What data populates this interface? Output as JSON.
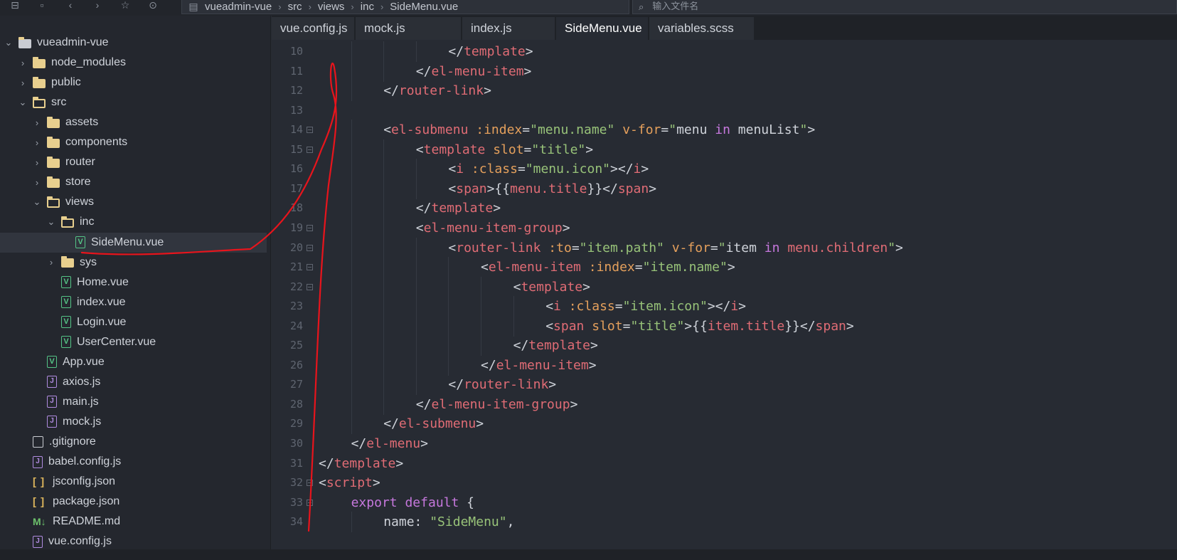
{
  "toolbar": {
    "breadcrumb": [
      "vueadmin-vue",
      "src",
      "views",
      "inc",
      "SideMenu.vue"
    ],
    "search_placeholder": "输入文件名"
  },
  "sidebar": {
    "items": [
      {
        "label": "vueadmin-vue",
        "icon": "project-icon",
        "chevron": "down"
      },
      {
        "label": "node_modules",
        "icon": "folder-icon",
        "chevron": "right"
      },
      {
        "label": "public",
        "icon": "folder-icon",
        "chevron": "right"
      },
      {
        "label": "src",
        "icon": "folder-open-icon",
        "chevron": "down"
      },
      {
        "label": "assets",
        "icon": "folder-icon",
        "chevron": "right"
      },
      {
        "label": "components",
        "icon": "folder-icon",
        "chevron": "right"
      },
      {
        "label": "router",
        "icon": "folder-icon",
        "chevron": "right"
      },
      {
        "label": "store",
        "icon": "folder-icon",
        "chevron": "right"
      },
      {
        "label": "views",
        "icon": "folder-open-icon",
        "chevron": "down"
      },
      {
        "label": "inc",
        "icon": "folder-open-icon",
        "chevron": "down"
      },
      {
        "label": "SideMenu.vue",
        "icon": "vue-file-icon",
        "chevron": ""
      },
      {
        "label": "sys",
        "icon": "folder-icon",
        "chevron": "right"
      },
      {
        "label": "Home.vue",
        "icon": "vue-file-icon",
        "chevron": ""
      },
      {
        "label": "index.vue",
        "icon": "vue-file-icon",
        "chevron": ""
      },
      {
        "label": "Login.vue",
        "icon": "vue-file-icon",
        "chevron": ""
      },
      {
        "label": "UserCenter.vue",
        "icon": "vue-file-icon",
        "chevron": ""
      },
      {
        "label": "App.vue",
        "icon": "vue-file-icon",
        "chevron": ""
      },
      {
        "label": "axios.js",
        "icon": "js-file-icon",
        "chevron": ""
      },
      {
        "label": "main.js",
        "icon": "js-file-icon",
        "chevron": ""
      },
      {
        "label": "mock.js",
        "icon": "js-file-icon",
        "chevron": ""
      },
      {
        "label": ".gitignore",
        "icon": "text-file-icon",
        "chevron": ""
      },
      {
        "label": "babel.config.js",
        "icon": "js-file-icon",
        "chevron": ""
      },
      {
        "label": "jsconfig.json",
        "icon": "json-file-icon",
        "chevron": ""
      },
      {
        "label": "package.json",
        "icon": "json-file-icon",
        "chevron": ""
      },
      {
        "label": "README.md",
        "icon": "markdown-file-icon",
        "chevron": ""
      },
      {
        "label": "vue.config.js",
        "icon": "js-file-icon",
        "chevron": ""
      }
    ]
  },
  "tabs": [
    {
      "label": "vue.config.js",
      "active": false
    },
    {
      "label": "mock.js",
      "active": false
    },
    {
      "label": "index.js",
      "active": false
    },
    {
      "label": "SideMenu.vue",
      "active": true
    },
    {
      "label": "variables.scss",
      "active": false
    }
  ],
  "editor": {
    "lines": [
      {
        "n": "10",
        "fold": false,
        "indent": 4,
        "tokens": [
          [
            "pun",
            "</"
          ],
          [
            "tag",
            "template"
          ],
          [
            "pun",
            ">"
          ]
        ]
      },
      {
        "n": "11",
        "fold": false,
        "indent": 3,
        "tokens": [
          [
            "pun",
            "</"
          ],
          [
            "tag",
            "el-menu-item"
          ],
          [
            "pun",
            ">"
          ]
        ]
      },
      {
        "n": "12",
        "fold": false,
        "indent": 2,
        "tokens": [
          [
            "pun",
            "</"
          ],
          [
            "tag",
            "router-link"
          ],
          [
            "pun",
            ">"
          ]
        ]
      },
      {
        "n": "13",
        "fold": false,
        "indent": 0,
        "tokens": []
      },
      {
        "n": "14",
        "fold": true,
        "indent": 2,
        "tokens": [
          [
            "pun",
            "<"
          ],
          [
            "tag",
            "el-submenu"
          ],
          [
            "pun",
            " "
          ],
          [
            "attr",
            ":index"
          ],
          [
            "pun",
            "="
          ],
          [
            "str",
            "\"menu.name\""
          ],
          [
            "pun",
            " "
          ],
          [
            "attr",
            "v-for"
          ],
          [
            "pun",
            "="
          ],
          [
            "str",
            "\""
          ],
          [
            "pun",
            "menu "
          ],
          [
            "kw",
            "in"
          ],
          [
            "pun",
            " menuList"
          ],
          [
            "str",
            "\""
          ],
          [
            "pun",
            ">"
          ]
        ]
      },
      {
        "n": "15",
        "fold": true,
        "indent": 3,
        "tokens": [
          [
            "pun",
            "<"
          ],
          [
            "tag",
            "template"
          ],
          [
            "pun",
            " "
          ],
          [
            "attr",
            "slot"
          ],
          [
            "pun",
            "="
          ],
          [
            "str",
            "\"title\""
          ],
          [
            "pun",
            ">"
          ]
        ]
      },
      {
        "n": "16",
        "fold": false,
        "indent": 4,
        "tokens": [
          [
            "pun",
            "<"
          ],
          [
            "tag",
            "i"
          ],
          [
            "pun",
            " "
          ],
          [
            "attr",
            ":class"
          ],
          [
            "pun",
            "="
          ],
          [
            "str",
            "\"menu.icon\""
          ],
          [
            "pun",
            "></"
          ],
          [
            "tag",
            "i"
          ],
          [
            "pun",
            ">"
          ]
        ]
      },
      {
        "n": "17",
        "fold": false,
        "indent": 4,
        "tokens": [
          [
            "pun",
            "<"
          ],
          [
            "tag",
            "span"
          ],
          [
            "pun",
            ">{{"
          ],
          [
            "tag",
            "menu.title"
          ],
          [
            "pun",
            "}}</"
          ],
          [
            "tag",
            "span"
          ],
          [
            "pun",
            ">"
          ]
        ]
      },
      {
        "n": "18",
        "fold": false,
        "indent": 3,
        "tokens": [
          [
            "pun",
            "</"
          ],
          [
            "tag",
            "template"
          ],
          [
            "pun",
            ">"
          ]
        ]
      },
      {
        "n": "19",
        "fold": true,
        "indent": 3,
        "tokens": [
          [
            "pun",
            "<"
          ],
          [
            "tag",
            "el-menu-item-group"
          ],
          [
            "pun",
            ">"
          ]
        ]
      },
      {
        "n": "20",
        "fold": true,
        "indent": 4,
        "tokens": [
          [
            "pun",
            "<"
          ],
          [
            "tag",
            "router-link"
          ],
          [
            "pun",
            " "
          ],
          [
            "attr",
            ":to"
          ],
          [
            "pun",
            "="
          ],
          [
            "str",
            "\"item.path\""
          ],
          [
            "pun",
            " "
          ],
          [
            "attr",
            "v-for"
          ],
          [
            "pun",
            "="
          ],
          [
            "str",
            "\""
          ],
          [
            "pun",
            "item "
          ],
          [
            "kw",
            "in"
          ],
          [
            "pun",
            " "
          ],
          [
            "tag",
            "menu.children"
          ],
          [
            "str",
            "\""
          ],
          [
            "pun",
            ">"
          ]
        ]
      },
      {
        "n": "21",
        "fold": true,
        "indent": 5,
        "tokens": [
          [
            "pun",
            "<"
          ],
          [
            "tag",
            "el-menu-item"
          ],
          [
            "pun",
            " "
          ],
          [
            "attr",
            ":index"
          ],
          [
            "pun",
            "="
          ],
          [
            "str",
            "\"item.name\""
          ],
          [
            "pun",
            ">"
          ]
        ]
      },
      {
        "n": "22",
        "fold": true,
        "indent": 6,
        "tokens": [
          [
            "pun",
            "<"
          ],
          [
            "tag",
            "template"
          ],
          [
            "pun",
            ">"
          ]
        ]
      },
      {
        "n": "23",
        "fold": false,
        "indent": 7,
        "tokens": [
          [
            "pun",
            "<"
          ],
          [
            "tag",
            "i"
          ],
          [
            "pun",
            " "
          ],
          [
            "attr",
            ":class"
          ],
          [
            "pun",
            "="
          ],
          [
            "str",
            "\"item.icon\""
          ],
          [
            "pun",
            "></"
          ],
          [
            "tag",
            "i"
          ],
          [
            "pun",
            ">"
          ]
        ]
      },
      {
        "n": "24",
        "fold": false,
        "indent": 7,
        "tokens": [
          [
            "pun",
            "<"
          ],
          [
            "tag",
            "span"
          ],
          [
            "pun",
            " "
          ],
          [
            "attr",
            "slot"
          ],
          [
            "pun",
            "="
          ],
          [
            "str",
            "\"title\""
          ],
          [
            "pun",
            ">{{"
          ],
          [
            "tag",
            "item.title"
          ],
          [
            "pun",
            "}}</"
          ],
          [
            "tag",
            "span"
          ],
          [
            "pun",
            ">"
          ]
        ]
      },
      {
        "n": "25",
        "fold": false,
        "indent": 6,
        "tokens": [
          [
            "pun",
            "</"
          ],
          [
            "tag",
            "template"
          ],
          [
            "pun",
            ">"
          ]
        ]
      },
      {
        "n": "26",
        "fold": false,
        "indent": 5,
        "tokens": [
          [
            "pun",
            "</"
          ],
          [
            "tag",
            "el-menu-item"
          ],
          [
            "pun",
            ">"
          ]
        ]
      },
      {
        "n": "27",
        "fold": false,
        "indent": 4,
        "tokens": [
          [
            "pun",
            "</"
          ],
          [
            "tag",
            "router-link"
          ],
          [
            "pun",
            ">"
          ]
        ]
      },
      {
        "n": "28",
        "fold": false,
        "indent": 3,
        "tokens": [
          [
            "pun",
            "</"
          ],
          [
            "tag",
            "el-menu-item-group"
          ],
          [
            "pun",
            ">"
          ]
        ]
      },
      {
        "n": "29",
        "fold": false,
        "indent": 2,
        "tokens": [
          [
            "pun",
            "</"
          ],
          [
            "tag",
            "el-submenu"
          ],
          [
            "pun",
            ">"
          ]
        ]
      },
      {
        "n": "30",
        "fold": false,
        "indent": 1,
        "tokens": [
          [
            "pun",
            "</"
          ],
          [
            "tag",
            "el-menu"
          ],
          [
            "pun",
            ">"
          ]
        ]
      },
      {
        "n": "31",
        "fold": false,
        "indent": 0,
        "tokens": [
          [
            "pun",
            "</"
          ],
          [
            "tag",
            "template"
          ],
          [
            "pun",
            ">"
          ]
        ]
      },
      {
        "n": "32",
        "fold": true,
        "indent": 0,
        "tokens": [
          [
            "pun",
            "<"
          ],
          [
            "tag",
            "script"
          ],
          [
            "pun",
            ">"
          ]
        ]
      },
      {
        "n": "33",
        "fold": true,
        "indent": 1,
        "tokens": [
          [
            "kw",
            "export"
          ],
          [
            "pun",
            " "
          ],
          [
            "kw",
            "default"
          ],
          [
            "pun",
            " {"
          ]
        ]
      },
      {
        "n": "34",
        "fold": false,
        "indent": 2,
        "tokens": [
          [
            "pun",
            "name: "
          ],
          [
            "str",
            "\"SideMenu\""
          ],
          [
            "pun",
            ","
          ]
        ]
      }
    ]
  },
  "colors": {
    "tag": "#e06c75",
    "attr": "#e5a05c",
    "str": "#98c379",
    "kw": "#c678dd",
    "annotation": "#e8141c"
  }
}
